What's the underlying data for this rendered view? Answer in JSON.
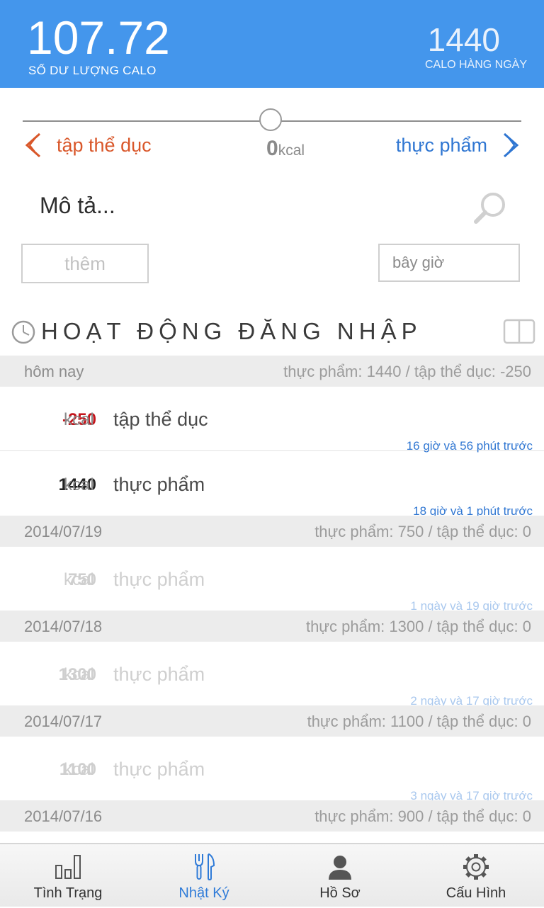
{
  "header": {
    "balance_value": "107.72",
    "balance_label": "SỐ DƯ LƯỢNG CALO",
    "daily_value": "1440",
    "daily_label": "CALO HÀNG NGÀY",
    "color": "#4496ec"
  },
  "slider": {
    "exercise_label": "tập thể dục",
    "food_label": "thực phẩm",
    "kcal_value": "0",
    "kcal_unit": "kcal",
    "position": 0.5
  },
  "entry_form": {
    "description_placeholder": "Mô tả...",
    "description_value": "",
    "add_label": "thêm",
    "time_value": "bây giờ"
  },
  "log_section": {
    "title": "HOẠT ĐỘNG ĐĂNG NHẬP"
  },
  "days": [
    {
      "date": "hôm nay",
      "summary": "thực phẩm: 1440 / tập thể dục: -250",
      "entries": [
        {
          "amount": "-250",
          "unit": "kcal",
          "label": "tập thể dục",
          "ago": "16 giờ và 56 phút trước"
        },
        {
          "amount": "1440",
          "unit": "kcal",
          "label": "thực phẩm",
          "ago": "18 giờ và 1 phút trước"
        }
      ]
    },
    {
      "date": "2014/07/19",
      "summary": "thực phẩm: 750 / tập thể dục: 0",
      "entries": [
        {
          "amount": "750",
          "unit": "kcal",
          "label": "thực phẩm",
          "ago": "1 ngày và 19 giờ trước"
        }
      ]
    },
    {
      "date": "2014/07/18",
      "summary": "thực phẩm: 1300 / tập thể dục: 0",
      "entries": [
        {
          "amount": "1300",
          "unit": "kcal",
          "label": "thực phẩm",
          "ago": "2 ngày và 17 giờ trước"
        }
      ]
    },
    {
      "date": "2014/07/17",
      "summary": "thực phẩm: 1100 / tập thể dục: 0",
      "entries": [
        {
          "amount": "1100",
          "unit": "kcal",
          "label": "thực phẩm",
          "ago": "3 ngày và 17 giờ trước"
        }
      ]
    },
    {
      "date": "2014/07/16",
      "summary": "thực phẩm: 900 / tập thể dục: 0",
      "entries": []
    }
  ],
  "nav": {
    "items": [
      {
        "label": "Tình Trạng",
        "icon": "bar-chart-icon"
      },
      {
        "label": "Nhật Ký",
        "icon": "fork-knife-icon",
        "active": true
      },
      {
        "label": "Hồ Sơ",
        "icon": "person-icon"
      },
      {
        "label": "Cấu Hình",
        "icon": "gear-icon"
      }
    ]
  },
  "colors": {
    "accent": "#2f76d2",
    "exercise": "#d9572a",
    "negative": "#c4141b"
  }
}
